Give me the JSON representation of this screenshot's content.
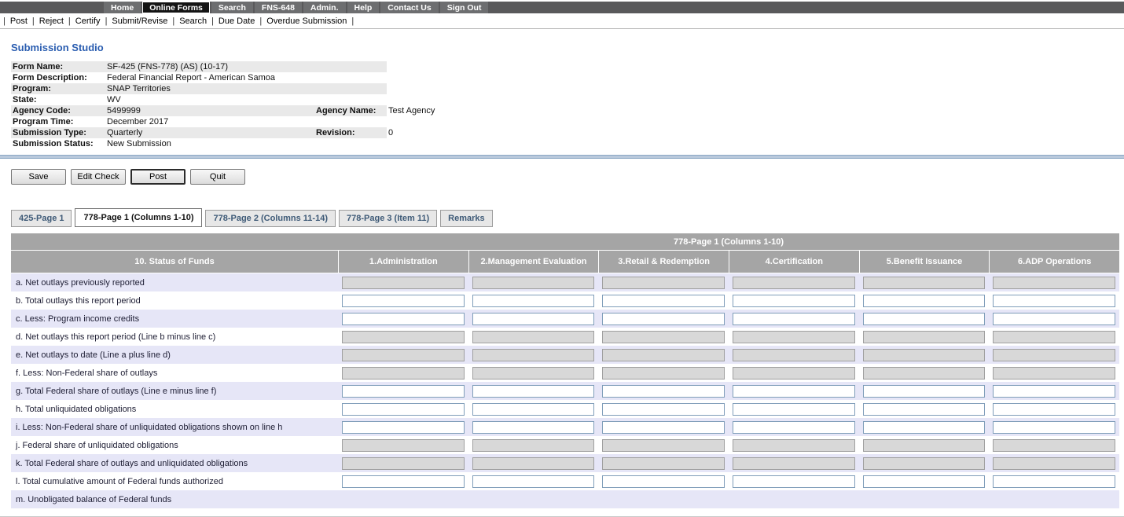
{
  "nav": {
    "items": [
      {
        "label": "Home",
        "active": false
      },
      {
        "label": "Online Forms",
        "active": true
      },
      {
        "label": "Search",
        "active": false
      },
      {
        "label": "FNS-648",
        "active": false
      },
      {
        "label": "Admin.",
        "active": false
      },
      {
        "label": "Help",
        "active": false
      },
      {
        "label": "Contact Us",
        "active": false
      },
      {
        "label": "Sign Out",
        "active": false
      }
    ]
  },
  "toolbar": {
    "items": [
      "Post",
      "Reject",
      "Certify",
      "Submit/Revise",
      "Search",
      "Due Date",
      "Overdue Submission"
    ]
  },
  "page_title": "Submission Studio",
  "form_info": {
    "rows": [
      {
        "label": "Form Name:",
        "value": "SF-425 (FNS-778) (AS) (10-17)",
        "label2": "",
        "value2": ""
      },
      {
        "label": "Form Description:",
        "value": "Federal Financial Report - American Samoa",
        "label2": "",
        "value2": ""
      },
      {
        "label": "Program:",
        "value": "SNAP Territories",
        "label2": "",
        "value2": ""
      },
      {
        "label": "State:",
        "value": "WV",
        "label2": "",
        "value2": ""
      },
      {
        "label": "Agency Code:",
        "value": "5499999",
        "label2": "Agency Name:",
        "value2": "Test Agency"
      },
      {
        "label": "Program Time:",
        "value": "December 2017",
        "label2": "",
        "value2": ""
      },
      {
        "label": "Submission Type:",
        "value": "Quarterly",
        "label2": "Revision:",
        "value2": "0"
      },
      {
        "label": "Submission Status:",
        "value": "New Submission",
        "label2": "",
        "value2": ""
      }
    ]
  },
  "buttons": {
    "save": "Save",
    "edit_check": "Edit Check",
    "post": "Post",
    "quit": "Quit"
  },
  "tabs": [
    {
      "label": "425-Page 1",
      "active": false
    },
    {
      "label": "778-Page 1 (Columns 1-10)",
      "active": true
    },
    {
      "label": "778-Page 2 (Columns 11-14)",
      "active": false
    },
    {
      "label": "778-Page 3 (Item 11)",
      "active": false
    },
    {
      "label": "Remarks",
      "active": false
    }
  ],
  "grid": {
    "caption": "778-Page 1 (Columns 1-10)",
    "row_header": "10. Status of Funds",
    "columns": [
      "1.Administration",
      "2.Management Evaluation",
      "3.Retail & Redemption",
      "4.Certification",
      "5.Benefit Issuance",
      "6.ADP Operations"
    ],
    "rows": [
      {
        "label": "a. Net outlays previously reported",
        "inputs": "disabled",
        "values": [
          "",
          "",
          "",
          "",
          "",
          ""
        ]
      },
      {
        "label": "b. Total outlays this report period",
        "inputs": "enabled",
        "values": [
          "",
          "",
          "",
          "",
          "",
          ""
        ]
      },
      {
        "label": "c. Less: Program income credits",
        "inputs": "enabled",
        "values": [
          "",
          "",
          "",
          "",
          "",
          ""
        ]
      },
      {
        "label": "d. Net outlays this report period (Line b minus line c)",
        "inputs": "disabled",
        "values": [
          "",
          "",
          "",
          "",
          "",
          ""
        ]
      },
      {
        "label": "e. Net outlays to date (Line a plus line d)",
        "inputs": "disabled",
        "values": [
          "",
          "",
          "",
          "",
          "",
          ""
        ]
      },
      {
        "label": "f. Less: Non-Federal share of outlays",
        "inputs": "disabled",
        "values": [
          "",
          "",
          "",
          "",
          "",
          ""
        ]
      },
      {
        "label": "g. Total Federal share of outlays (Line e minus line f)",
        "inputs": "enabled",
        "values": [
          "",
          "",
          "",
          "",
          "",
          ""
        ]
      },
      {
        "label": "h. Total unliquidated obligations",
        "inputs": "enabled",
        "values": [
          "",
          "",
          "",
          "",
          "",
          ""
        ]
      },
      {
        "label": "i. Less: Non-Federal share of unliquidated obligations shown on line h",
        "inputs": "enabled",
        "values": [
          "",
          "",
          "",
          "",
          "",
          ""
        ]
      },
      {
        "label": "j. Federal share of unliquidated obligations",
        "inputs": "disabled",
        "values": [
          "",
          "",
          "",
          "",
          "",
          ""
        ]
      },
      {
        "label": "k. Total Federal share of outlays and unliquidated obligations",
        "inputs": "disabled",
        "values": [
          "",
          "",
          "",
          "",
          "",
          ""
        ]
      },
      {
        "label": "l. Total cumulative amount of Federal funds authorized",
        "inputs": "enabled",
        "values": [
          "",
          "",
          "",
          "",
          "",
          ""
        ]
      },
      {
        "label": "m. Unobligated balance of Federal funds",
        "inputs": "none",
        "values": [
          "",
          "",
          "",
          "",
          "",
          ""
        ]
      }
    ]
  },
  "colors": {
    "accent_blue": "#2a5db0",
    "nav_dark": "#59595b",
    "nav_item_bg": "#6d6e70",
    "nav_active_bg": "#141414",
    "header_gray": "#a5a5a5",
    "row_lavender": "#e6e6f7",
    "shaded_info_row": "#e9e9e9",
    "disabled_input_bg": "#d8d8d8",
    "enabled_input_border": "#7f9db9",
    "divider_blue": "#b9c9dc"
  }
}
